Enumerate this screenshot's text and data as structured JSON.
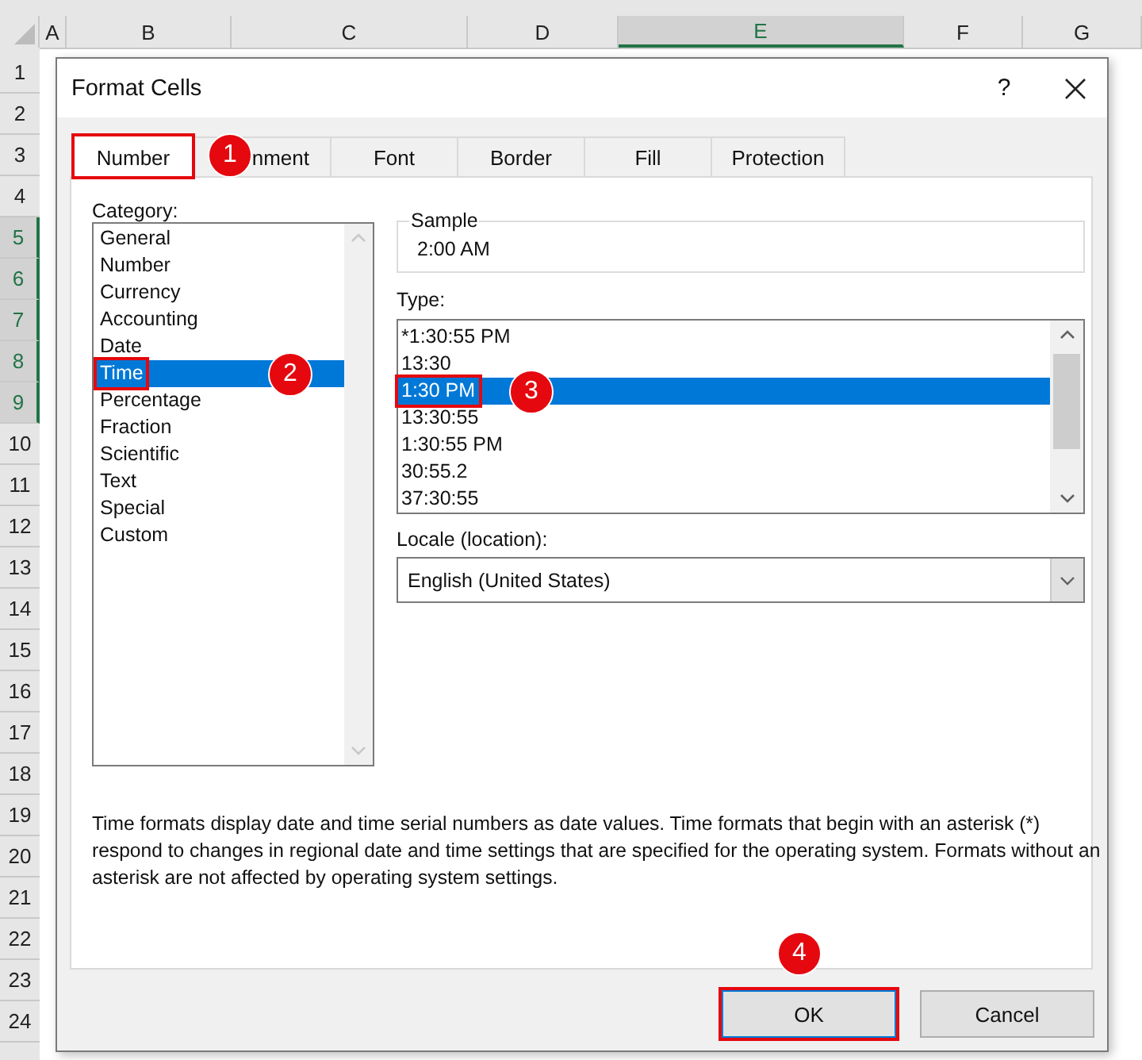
{
  "sheet": {
    "columns": [
      {
        "label": "A",
        "selected": false
      },
      {
        "label": "B",
        "selected": false
      },
      {
        "label": "C",
        "selected": false
      },
      {
        "label": "D",
        "selected": false
      },
      {
        "label": "E",
        "selected": true
      },
      {
        "label": "F",
        "selected": false
      },
      {
        "label": "G",
        "selected": false
      }
    ],
    "rows": [
      {
        "label": "1",
        "selected": false
      },
      {
        "label": "2",
        "selected": false
      },
      {
        "label": "3",
        "selected": false
      },
      {
        "label": "4",
        "selected": false
      },
      {
        "label": "5",
        "selected": true
      },
      {
        "label": "6",
        "selected": true
      },
      {
        "label": "7",
        "selected": true
      },
      {
        "label": "8",
        "selected": true
      },
      {
        "label": "9",
        "selected": true
      },
      {
        "label": "10",
        "selected": false
      },
      {
        "label": "11",
        "selected": false
      },
      {
        "label": "12",
        "selected": false
      },
      {
        "label": "13",
        "selected": false
      },
      {
        "label": "14",
        "selected": false
      },
      {
        "label": "15",
        "selected": false
      },
      {
        "label": "16",
        "selected": false
      },
      {
        "label": "17",
        "selected": false
      },
      {
        "label": "18",
        "selected": false
      },
      {
        "label": "19",
        "selected": false
      },
      {
        "label": "20",
        "selected": false
      },
      {
        "label": "21",
        "selected": false
      },
      {
        "label": "22",
        "selected": false
      },
      {
        "label": "23",
        "selected": false
      },
      {
        "label": "24",
        "selected": false
      }
    ]
  },
  "dialog": {
    "title": "Format Cells",
    "help": "?",
    "tabs": [
      {
        "label": "Number",
        "selected": true,
        "outlined": true,
        "callout": "1"
      },
      {
        "label": "nment",
        "selected": false,
        "outlined": false
      },
      {
        "label": "Font",
        "selected": false,
        "outlined": false
      },
      {
        "label": "Border",
        "selected": false,
        "outlined": false
      },
      {
        "label": "Fill",
        "selected": false,
        "outlined": false
      },
      {
        "label": "Protection",
        "selected": false,
        "outlined": false
      }
    ],
    "category": {
      "label": "Category:",
      "items": [
        {
          "label": "General",
          "selected": false,
          "outlined": false
        },
        {
          "label": "Number",
          "selected": false,
          "outlined": false
        },
        {
          "label": "Currency",
          "selected": false,
          "outlined": false
        },
        {
          "label": "Accounting",
          "selected": false,
          "outlined": false
        },
        {
          "label": "Date",
          "selected": false,
          "outlined": false
        },
        {
          "label": "Time",
          "selected": true,
          "outlined": true,
          "callout": "2"
        },
        {
          "label": "Percentage",
          "selected": false,
          "outlined": false
        },
        {
          "label": "Fraction",
          "selected": false,
          "outlined": false
        },
        {
          "label": "Scientific",
          "selected": false,
          "outlined": false
        },
        {
          "label": "Text",
          "selected": false,
          "outlined": false
        },
        {
          "label": "Special",
          "selected": false,
          "outlined": false
        },
        {
          "label": "Custom",
          "selected": false,
          "outlined": false
        }
      ]
    },
    "sample": {
      "label": "Sample",
      "value": "2:00 AM"
    },
    "type": {
      "label": "Type:",
      "items": [
        {
          "label": "*1:30:55 PM",
          "selected": false,
          "outlined": false
        },
        {
          "label": "13:30",
          "selected": false,
          "outlined": false
        },
        {
          "label": "1:30 PM",
          "selected": true,
          "outlined": true,
          "callout": "3"
        },
        {
          "label": "13:30:55",
          "selected": false,
          "outlined": false
        },
        {
          "label": "1:30:55 PM",
          "selected": false,
          "outlined": false
        },
        {
          "label": "30:55.2",
          "selected": false,
          "outlined": false
        },
        {
          "label": "37:30:55",
          "selected": false,
          "outlined": false
        }
      ]
    },
    "locale": {
      "label": "Locale (location):",
      "value": "English (United States)"
    },
    "description": "Time formats display date and time serial numbers as date values.  Time formats that begin with an asterisk (*) respond to changes in regional date and time settings that are specified for the operating system. Formats without an asterisk are not affected by operating system settings.",
    "buttons": [
      {
        "label": "OK",
        "outlined": true,
        "callout": "4"
      },
      {
        "label": "Cancel",
        "outlined": false
      }
    ]
  }
}
